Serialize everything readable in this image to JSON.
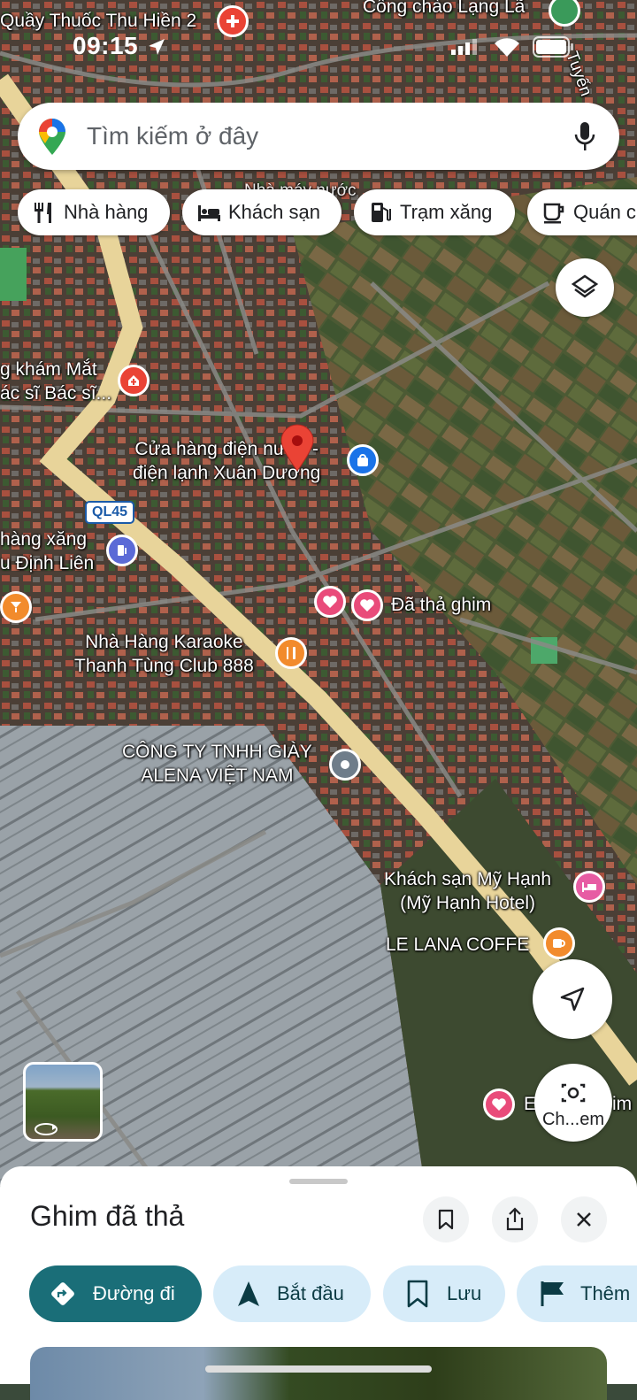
{
  "status_bar": {
    "time": "09:15"
  },
  "search": {
    "placeholder": "Tìm kiếm ở đây"
  },
  "chips": [
    {
      "label": "Nhà hàng",
      "icon": "fork-knife-icon"
    },
    {
      "label": "Khách sạn",
      "icon": "bed-icon"
    },
    {
      "label": "Trạm xăng",
      "icon": "gas-station-icon"
    },
    {
      "label": "Quán c",
      "icon": "coffee-icon"
    }
  ],
  "map_labels": {
    "pharmacy": "Quầy Thuốc Thu Hiền 2",
    "gate": "Cổng chào Lạng Lã",
    "road_side": "Tuyến",
    "water_shop": "Nhà máy nước",
    "clinic_1": "g khám Mắt",
    "clinic_2": "ác sĩ Bác sĩ...",
    "dropped_shop_1": "Cửa hàng điện nước -",
    "dropped_shop_2": "điện lạnh Xuân Dương",
    "road_shield": "QL45",
    "gas_1": "hàng xăng",
    "gas_2": "u Định Liên",
    "saved_pin": "Đã thả ghim",
    "karaoke_1": "Nhà Hàng Karaoke",
    "karaoke_2": "Thanh Tùng Club 888",
    "company_1": "CÔNG TY TNHH GIÀY",
    "company_2": "ALENA VIỆT NAM",
    "hotel_1": "Khách sạn Mỹ Hạnh",
    "hotel_2": "(Mỹ Hạnh Hotel)",
    "coffee": "LE LANA COFFE",
    "bottom_right_1": "E",
    "bottom_right_2": "im",
    "lens_label": "Ch...em"
  },
  "sheet": {
    "title": "Ghim đã thả",
    "actions": [
      {
        "label": "Đường đi",
        "icon": "directions-icon"
      },
      {
        "label": "Bắt đầu",
        "icon": "navigation-arrow-icon"
      },
      {
        "label": "Lưu",
        "icon": "bookmark-icon"
      },
      {
        "label": "Thêm",
        "icon": "flag-icon"
      }
    ]
  },
  "colors": {
    "accent": "#1a6e78",
    "action_bg": "#d7ecf9",
    "pin_red": "#ea4335",
    "saved_pink": "#e94b7a",
    "shop_blue": "#1a73e8",
    "food_orange": "#f28b2c",
    "hotel_pink": "#e75ca3",
    "road_yellow": "#e8d49a"
  }
}
